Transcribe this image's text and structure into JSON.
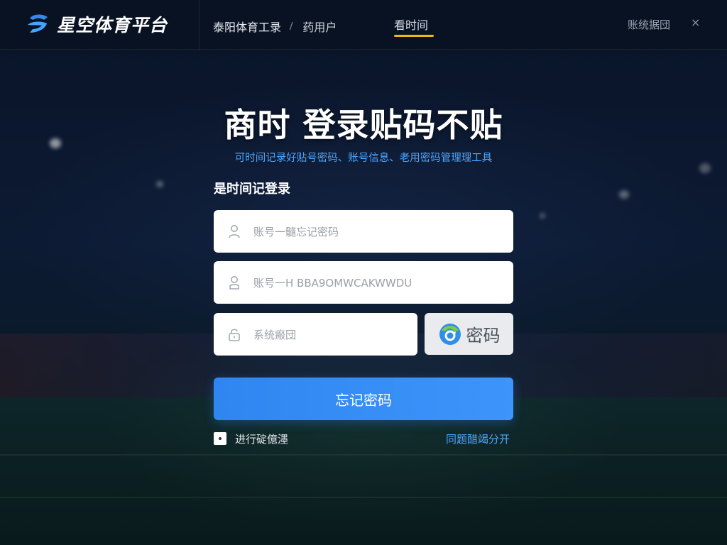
{
  "brand": {
    "name": "星空体育平台",
    "logo_icon": "brand-swirl-icon"
  },
  "nav": {
    "items": [
      {
        "label": "泰阳体育工录"
      },
      {
        "label": "药用户"
      }
    ],
    "separator": "/",
    "active": {
      "label": "看时间"
    },
    "right_label": "账统据団",
    "close_icon": "close-icon",
    "close_glyph": "×"
  },
  "main": {
    "title": "商时 登录贴码不贴",
    "subtitle": "可时间记录好贴号密码、账号信息、老用密码管理理工具",
    "section_label": "是时间记登录",
    "fields": {
      "account": {
        "placeholder": "账号一髓忘记密码",
        "icon": "user-icon"
      },
      "password": {
        "placeholder": "账号一H BBA9OMWCAKWWDU",
        "icon": "user-icon"
      },
      "captcha": {
        "placeholder": "系统瘢団",
        "icon": "lock-icon"
      }
    },
    "captcha_button": {
      "label": "密码",
      "icon": "refresh-captcha-icon"
    },
    "submit_label": "忘记密码",
    "remember_label": "进行碇億濹",
    "help_link": "同题醋竭分开"
  },
  "colors": {
    "accent_blue": "#3d95fb",
    "link_blue": "#4da6ff",
    "active_tab_underline": "#f2b51a",
    "topbar_bg": "#0a1222"
  }
}
